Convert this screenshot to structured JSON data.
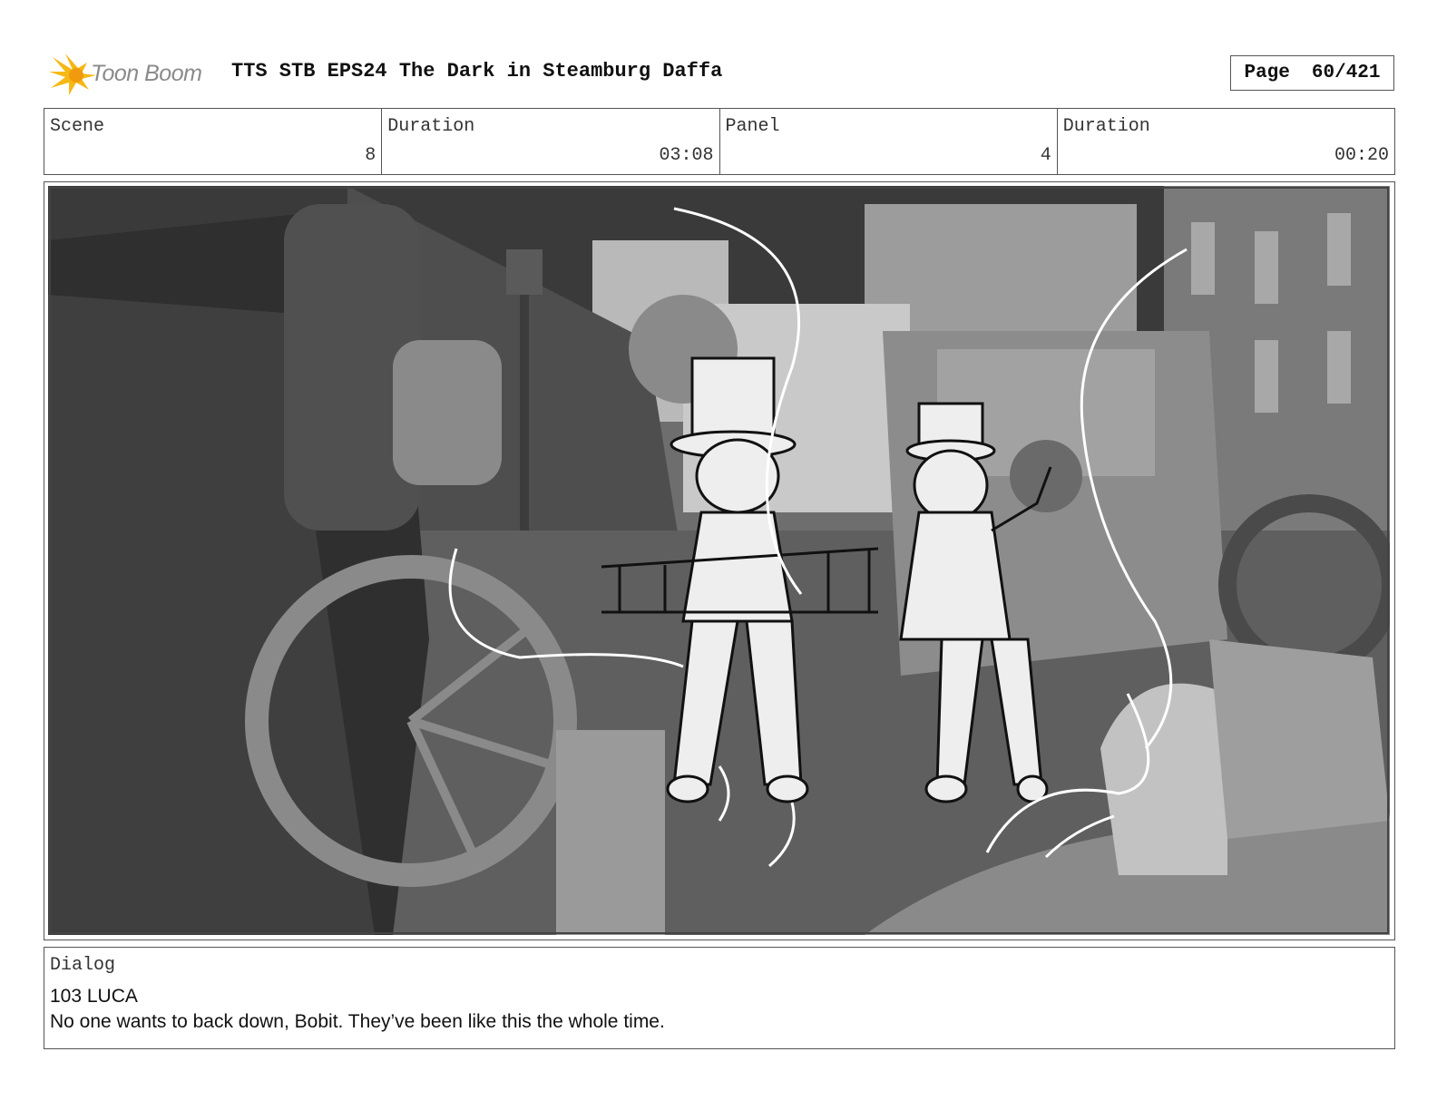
{
  "header": {
    "logo_text": "Toon Boom",
    "title": "TTS STB EPS24 The Dark in Steamburg Daffa",
    "page_label": "Page",
    "page_value": "60/421"
  },
  "info": {
    "scene_label": "Scene",
    "scene_value": "8",
    "scene_duration_label": "Duration",
    "scene_duration_value": "03:08",
    "panel_label": "Panel",
    "panel_value": "4",
    "panel_duration_label": "Duration",
    "panel_duration_value": "00:20"
  },
  "dialog": {
    "label": "Dialog",
    "speaker": "103 LUCA",
    "line": "No one wants to back down, Bobit. They’ve been like this the whole time."
  }
}
